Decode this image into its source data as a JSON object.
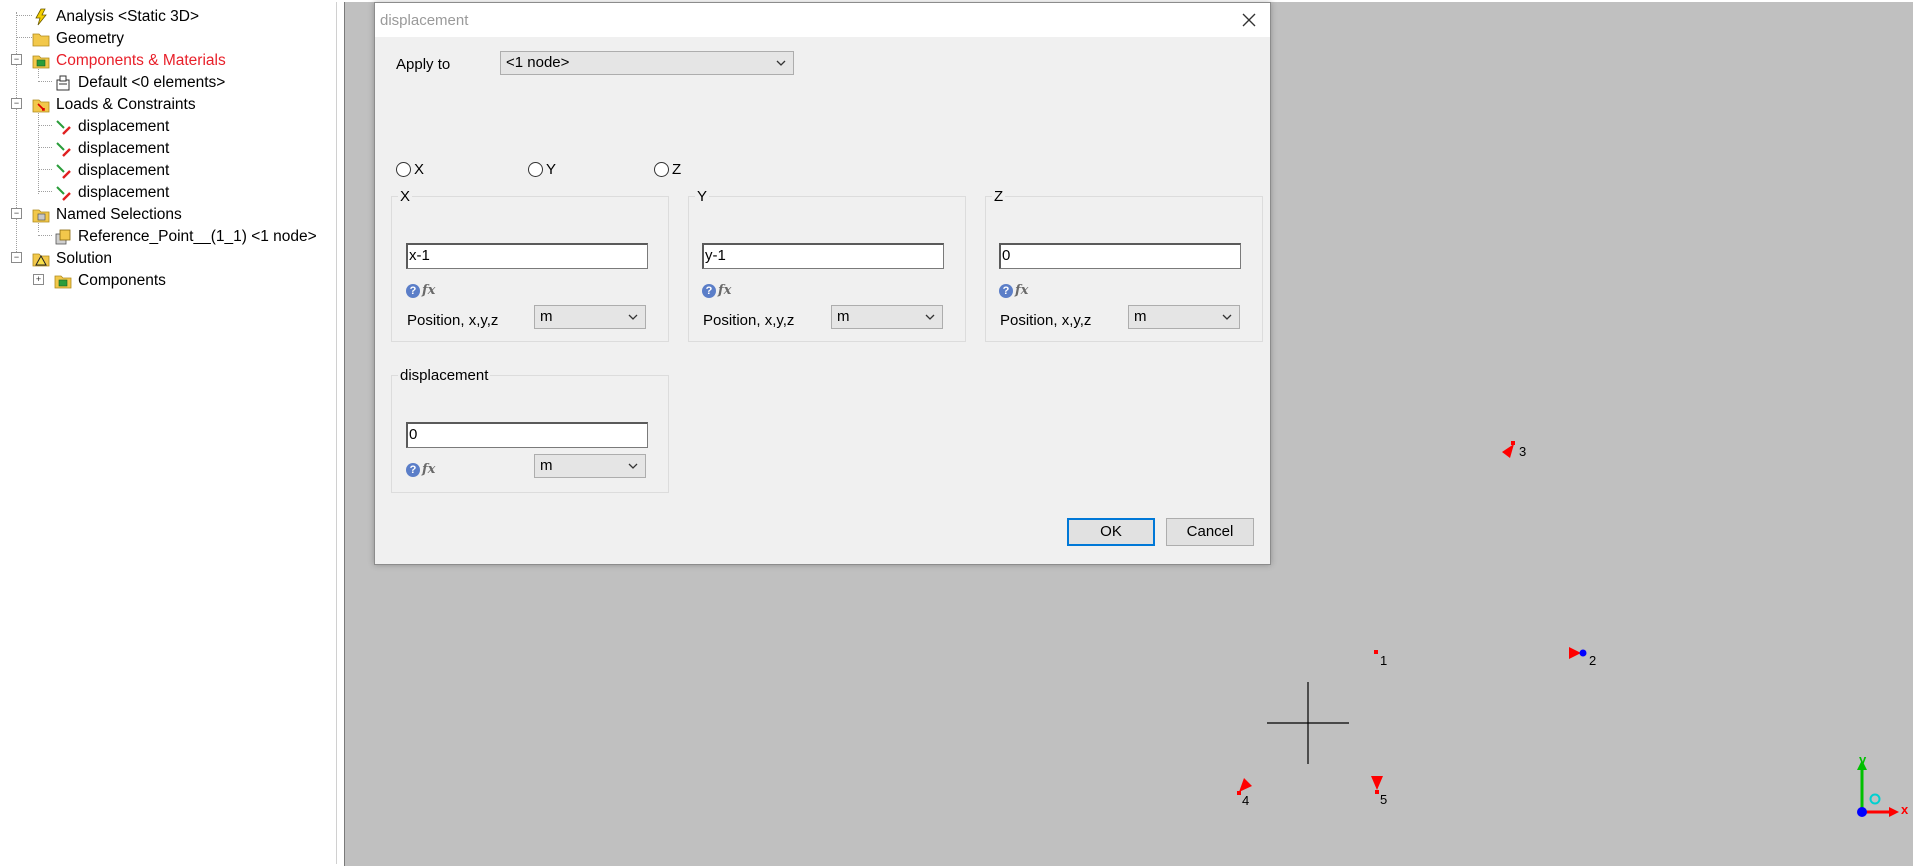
{
  "tree": {
    "items": [
      {
        "label": "Analysis <Static 3D>",
        "icon": "lightning-icon"
      },
      {
        "label": "Geometry",
        "icon": "folder-icon"
      },
      {
        "label": "Components & Materials",
        "icon": "components-icon"
      },
      {
        "label": "Default <0 elements>",
        "icon": "material-icon"
      },
      {
        "label": "Loads & Constraints",
        "icon": "loads-folder-icon"
      },
      {
        "label": "displacement",
        "icon": "displacement-icon"
      },
      {
        "label": "displacement",
        "icon": "displacement-icon"
      },
      {
        "label": "displacement",
        "icon": "displacement-icon"
      },
      {
        "label": "displacement",
        "icon": "displacement-icon"
      },
      {
        "label": "Named Selections",
        "icon": "named-selections-icon"
      },
      {
        "label": "Reference_Point__(1_1) <1 node>",
        "icon": "selection-icon"
      },
      {
        "label": "Solution",
        "icon": "solution-icon"
      },
      {
        "label": "Components",
        "icon": "components-icon"
      }
    ],
    "expander_collapsed": "+",
    "expander_expanded": "−"
  },
  "dialog": {
    "title": "displacement",
    "apply_to_label": "Apply to",
    "apply_to_value": "<1 node>",
    "radio_x": "X",
    "radio_y": "Y",
    "radio_z": "Z",
    "group_x": {
      "title": "X",
      "value": "x-1",
      "position_label": "Position, x,y,z",
      "unit": "m"
    },
    "group_y": {
      "title": "Y",
      "value": "y-1",
      "position_label": "Position, x,y,z",
      "unit": "m"
    },
    "group_z": {
      "title": "Z",
      "value": "0",
      "position_label": "Position, x,y,z",
      "unit": "m"
    },
    "group_disp": {
      "title": "displacement",
      "value": "0",
      "unit": "m"
    },
    "help_symbol": "?",
    "fx_symbol": "fx",
    "ok_label": "OK",
    "cancel_label": "Cancel"
  },
  "viewport": {
    "node_labels": [
      "1",
      "2",
      "3",
      "4",
      "5"
    ],
    "axis_x_label": "x",
    "axis_y_label": "y",
    "colors": {
      "background": "#c0c0c0",
      "marker": "#ff0000",
      "node_blue": "#0000ff",
      "axis_x": "#ff0000",
      "axis_y": "#00c000"
    }
  }
}
